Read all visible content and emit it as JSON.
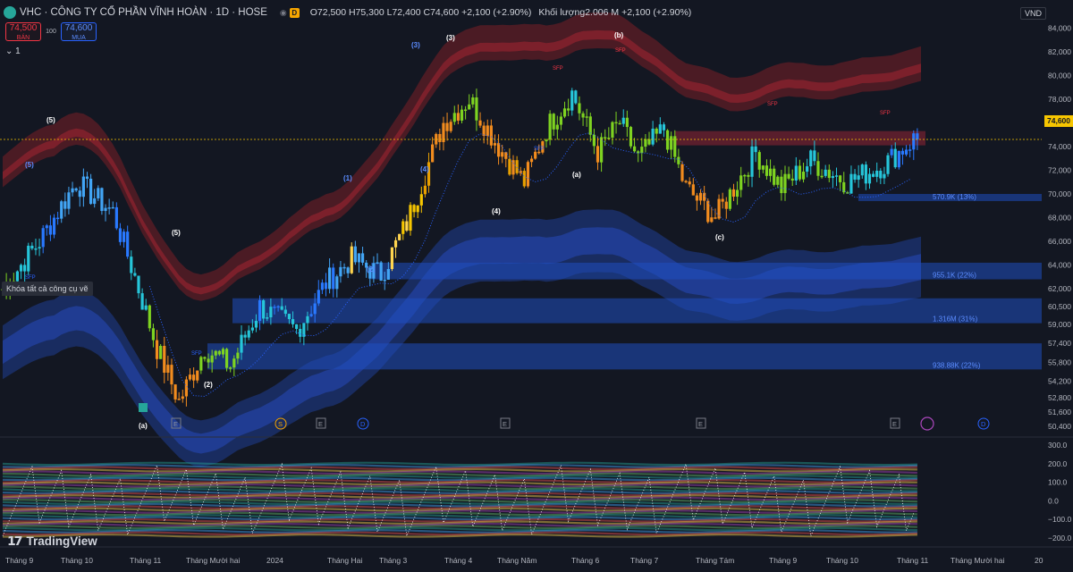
{
  "header": {
    "symbol": "VHC · CÔNG TY CỔ PHẦN VĨNH HOÀN · 1D · HOSE",
    "badge": "D",
    "open": "O72,500",
    "high": "H75,300",
    "low": "L72,400",
    "close": "C74,600",
    "change": "+2,100 (+2.90%)",
    "volume_label": "Khối lượng",
    "volume_value": "2.006 M",
    "volume_change": "+2,100 (+2.90%)"
  },
  "trade": {
    "sell_price": "74,500",
    "sell_label": "BÁN",
    "spread": "100",
    "buy_price": "74,600",
    "buy_label": "MUA"
  },
  "collapse_count": "1",
  "currency": "VND",
  "tooltip": "Khóa tất cả công cụ vẽ",
  "brand": "TradingView",
  "last_price": "74,600",
  "price_axis": [
    "84,000",
    "82,000",
    "80,000",
    "78,000",
    "76,000",
    "74,000",
    "72,000",
    "70,000",
    "68,000",
    "66,000",
    "64,000",
    "62,000",
    "60,500",
    "59,000",
    "57,400",
    "55,800",
    "54,200",
    "52,800",
    "51,600",
    "50,400"
  ],
  "osc_axis": [
    "300.0",
    "200.0",
    "100.0",
    "0.0",
    "−100.0",
    "−200.0"
  ],
  "time_axis": [
    "Tháng 9",
    "Tháng 10",
    "Tháng 11",
    "Tháng Mười hai",
    "2024",
    "Tháng Hai",
    "Tháng 3",
    "Tháng 4",
    "Tháng Năm",
    "Tháng 6",
    "Tháng 7",
    "Tháng Tám",
    "Tháng 9",
    "Tháng 10",
    "Tháng 11",
    "Tháng Mười hai",
    "20"
  ],
  "volume_profile": [
    "570.9K (13%)",
    "955.1K (22%)",
    "1.316M (31%)",
    "938.88K (22%)"
  ],
  "wave_labels": [
    "(5)",
    "(3)",
    "(b)",
    "(a)",
    "(4)",
    "(c)",
    "(2)",
    "(a)",
    "(5)",
    "(3)",
    "(4)",
    "(1)",
    "(2)",
    "(5)"
  ],
  "event_markers": [
    "E",
    "S",
    "E",
    "D",
    "E",
    "E",
    "E",
    "D"
  ],
  "signal_labels": [
    "SFP",
    "SFP",
    "SFP",
    "SFP",
    "SFP",
    "SFP",
    "SFP"
  ],
  "chart_data": {
    "type": "candlestick",
    "title": "VHC · CÔNG TY CỔ PHẦN VĨNH HOÀN · 1D · HOSE",
    "ylim": [
      49800,
      85000
    ],
    "last": 74600,
    "open": 72500,
    "high": 75300,
    "low": 72400,
    "close": 74600,
    "key_levels": [
      {
        "label": "(5)",
        "value": 72100,
        "month": "Tháng 9"
      },
      {
        "label": "(a)",
        "value": 52300,
        "month": "Tháng 11"
      },
      {
        "label": "(5)",
        "value": 77900,
        "month": "Tháng 3"
      },
      {
        "label": "(b)",
        "value": 78900,
        "month": "Tháng 6"
      },
      {
        "label": "(c)",
        "value": 66700,
        "month": "Tháng Tám"
      }
    ],
    "volume_profile_zones": [
      {
        "label": "570.9K (13%)",
        "from": 69400,
        "to": 70000
      },
      {
        "label": "955.1K (22%)",
        "from": 62800,
        "to": 64200
      },
      {
        "label": "1.316M (31%)",
        "from": 59100,
        "to": 61200
      },
      {
        "label": "938.88K (22%)",
        "from": 55200,
        "to": 57400
      }
    ],
    "oscillator": {
      "ylim": [
        -230,
        330
      ],
      "ticks": [
        300,
        200,
        100,
        0,
        -100,
        -200
      ]
    }
  }
}
